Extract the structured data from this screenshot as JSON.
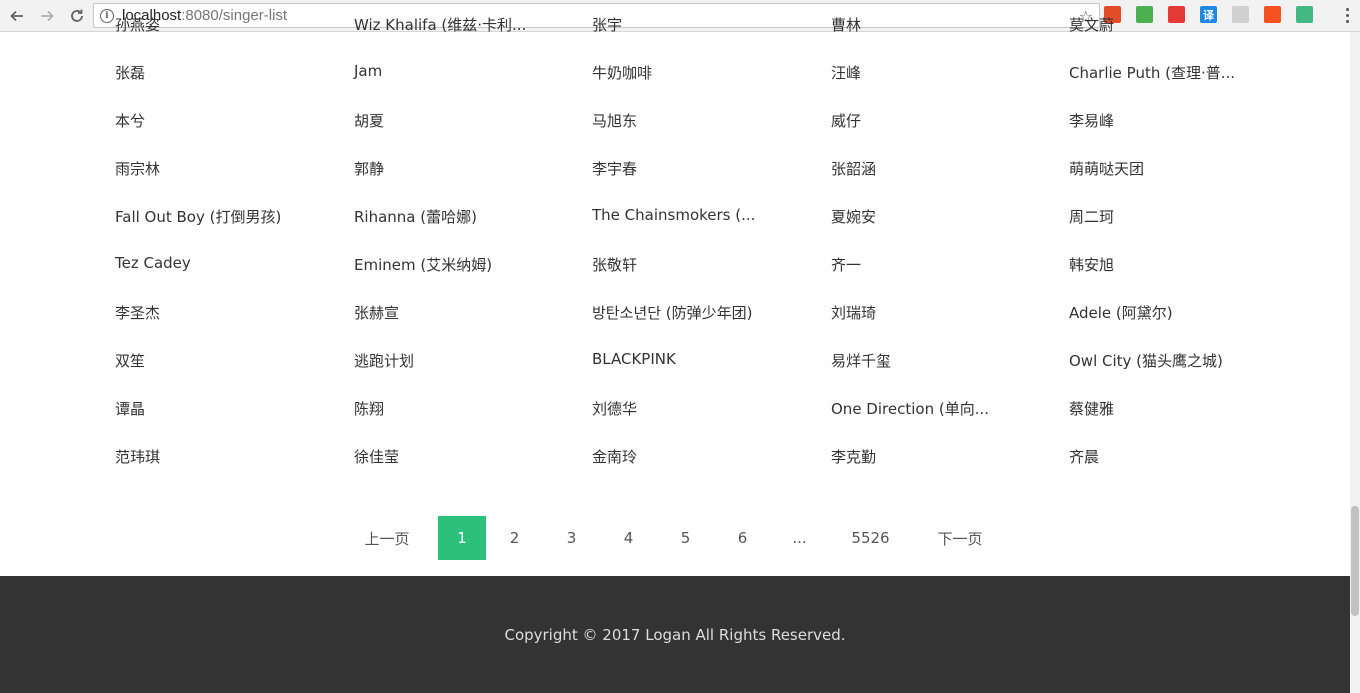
{
  "browser": {
    "url_host": "localhost",
    "url_path": ":8080/singer-list",
    "info_icon": "i",
    "star_icon": "☆"
  },
  "extensions": [
    {
      "name": "notes-extension-icon",
      "color": "#e34c26",
      "glyph": ""
    },
    {
      "name": "chrome-extension-icon",
      "color": "#4caf50",
      "glyph": ""
    },
    {
      "name": "block-extension-icon",
      "color": "#e53935",
      "glyph": ""
    },
    {
      "name": "translate-extension-icon",
      "color": "#1e88e5",
      "glyph": "译"
    },
    {
      "name": "leaf-extension-icon",
      "color": "#d0d0d0",
      "glyph": ""
    },
    {
      "name": "tools-extension-icon",
      "color": "#f4511e",
      "glyph": ""
    },
    {
      "name": "vue-devtools-icon",
      "color": "#42b883",
      "glyph": ""
    }
  ],
  "singers": [
    [
      "孙燕姿",
      "Wiz Khalifa (维兹·卡利...",
      "张宇",
      "曹林",
      "莫文蔚"
    ],
    [
      "张磊",
      "Jam",
      "牛奶咖啡",
      "汪峰",
      "Charlie Puth (查理·普..."
    ],
    [
      "本兮",
      "胡夏",
      "马旭东",
      "威仔",
      "李易峰"
    ],
    [
      "雨宗林",
      "郭静",
      "李宇春",
      "张韶涵",
      "萌萌哒天团"
    ],
    [
      "Fall Out Boy (打倒男孩)",
      "Rihanna (蕾哈娜)",
      "The Chainsmokers (...",
      "夏婉安",
      "周二珂"
    ],
    [
      "Tez Cadey",
      "Eminem (艾米纳姆)",
      "张敬轩",
      "齐一",
      "韩安旭"
    ],
    [
      "李圣杰",
      "张赫宣",
      "방탄소년단 (防弹少年团)",
      "刘瑞琦",
      "Adele (阿黛尔)"
    ],
    [
      "双笙",
      "逃跑计划",
      "BLACKPINK",
      "易烊千玺",
      "Owl City (猫头鹰之城)"
    ],
    [
      "谭晶",
      "陈翔",
      "刘德华",
      "One Direction (单向...",
      "蔡健雅"
    ],
    [
      "范玮琪",
      "徐佳莹",
      "金南玲",
      "李克勤",
      "齐晨"
    ]
  ],
  "pagination": {
    "prev": "上一页",
    "pages": [
      "1",
      "2",
      "3",
      "4",
      "5",
      "6",
      "...",
      "5526"
    ],
    "current": "1",
    "next": "下一页"
  },
  "footer": {
    "text": "Copyright © 2017 Logan All Rights Reserved."
  },
  "colors": {
    "accent": "#2cc17b",
    "footer_bg": "#333333"
  }
}
